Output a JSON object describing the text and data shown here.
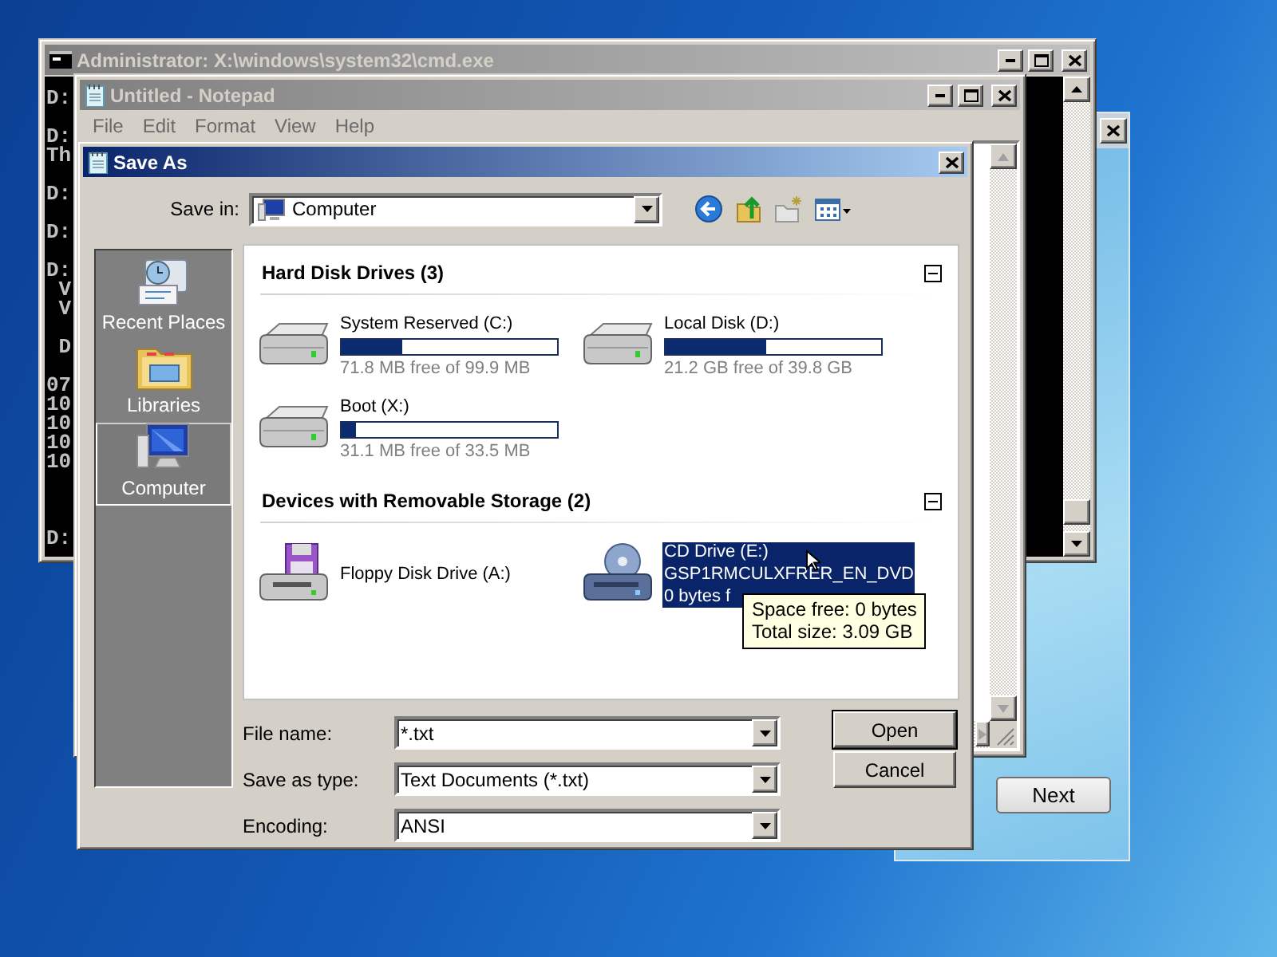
{
  "cmd_window": {
    "title": "Administrator: X:\\windows\\system32\\cmd.exe",
    "console_lines": [
      "D:",
      "D:",
      "Th",
      "D:",
      "D:",
      "D:",
      " V",
      " V",
      " D",
      "07",
      "10",
      "10",
      "10",
      "10",
      "D:"
    ]
  },
  "setup_window": {
    "next_button": "Next"
  },
  "notepad_window": {
    "title": "Untitled - Notepad",
    "menu": [
      "File",
      "Edit",
      "Format",
      "View",
      "Help"
    ]
  },
  "save_as_dialog": {
    "title": "Save As",
    "save_in": {
      "label": "Save in:",
      "value": "Computer"
    },
    "places": [
      {
        "label": "Recent Places",
        "kind": "recent",
        "selected": false
      },
      {
        "label": "Libraries",
        "kind": "libraries",
        "selected": false
      },
      {
        "label": "Computer",
        "kind": "computer",
        "selected": true
      }
    ],
    "groups": [
      {
        "title": "Hard Disk Drives (3)",
        "expanded": true,
        "drives": [
          {
            "kind": "hdd",
            "name": "System Reserved (C:)",
            "level": 0.28,
            "free": "71.8 MB free of 99.9 MB",
            "selected": false
          },
          {
            "kind": "hdd",
            "name": "Local Disk (D:)",
            "level": 0.47,
            "free": "21.2 GB free of 39.8 GB",
            "selected": false
          },
          {
            "kind": "hdd",
            "name": "Boot (X:)",
            "level": 0.07,
            "free": "31.1 MB free of 33.5 MB",
            "selected": false
          }
        ]
      },
      {
        "title": "Devices with Removable Storage (2)",
        "expanded": true,
        "drives": [
          {
            "kind": "floppy",
            "name": "Floppy Disk Drive (A:)",
            "selected": false
          },
          {
            "kind": "cd",
            "name": "CD Drive (E:)",
            "label": "GSP1RMCULXFRER_EN_DVD",
            "free": "0 bytes f",
            "selected": true
          }
        ]
      }
    ],
    "tooltip": [
      "Space free: 0 bytes",
      "Total size: 3.09 GB"
    ],
    "fields": [
      {
        "label": "File name:",
        "value": "*.txt"
      },
      {
        "label": "Save as type:",
        "value": "Text Documents (*.txt)"
      },
      {
        "label": "Encoding:",
        "value": "ANSI"
      }
    ],
    "buttons": [
      {
        "label": "Open",
        "default": true
      },
      {
        "label": "Cancel",
        "default": false
      }
    ]
  }
}
